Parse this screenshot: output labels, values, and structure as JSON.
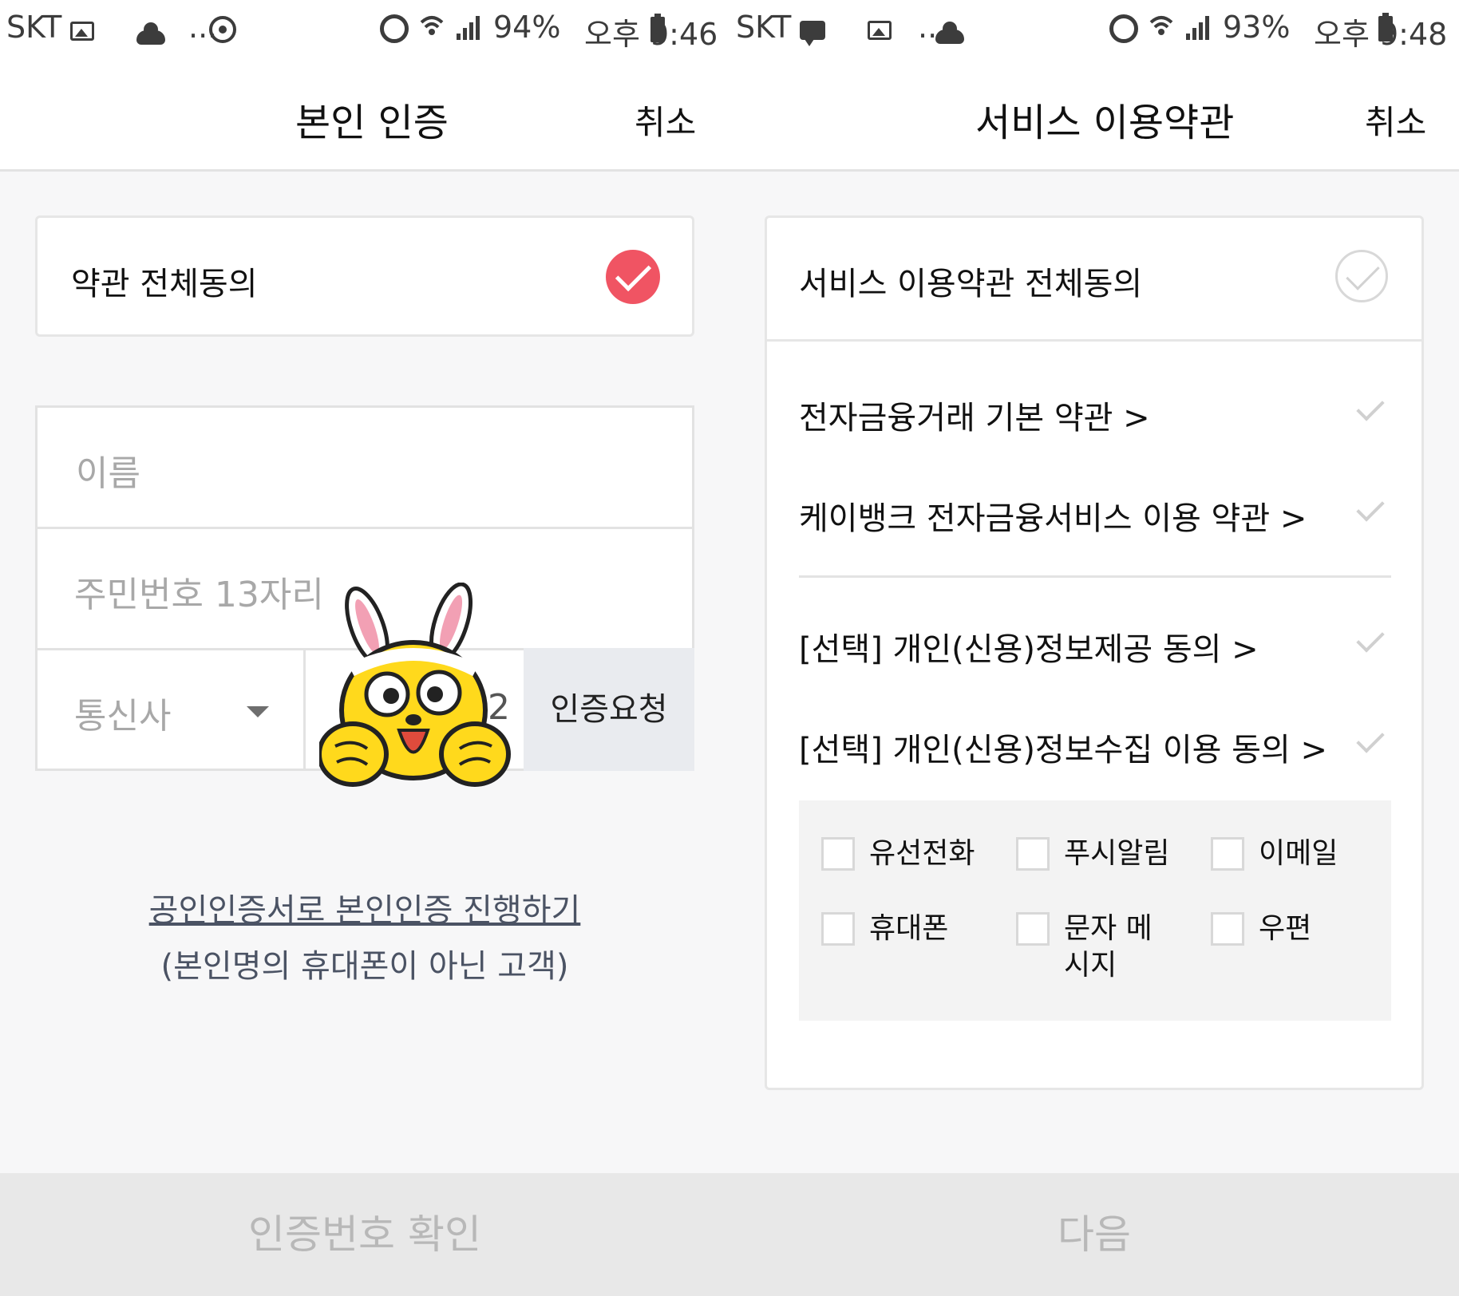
{
  "left": {
    "status": {
      "carrier": "SKT",
      "dots": "...",
      "battery": "94%",
      "time": "오후 9:46"
    },
    "header": {
      "title": "본인 인증",
      "cancel": "취소"
    },
    "agree_all": {
      "label": "약관 전체동의",
      "checked": true,
      "check_color": "#f05463"
    },
    "form": {
      "name_placeholder": "이름",
      "rrn_placeholder": "주민번호 13자리",
      "carrier_placeholder": "통신사",
      "phone_partial": "2",
      "request_button": "인증요청"
    },
    "links": {
      "cert_link": "공인인증서로 본인인증 진행하기",
      "cert_note": "(본인명의 휴대폰이 아닌 고객)"
    },
    "bottom_button": "인증번호 확인"
  },
  "right": {
    "status": {
      "carrier": "SKT",
      "dots": "...",
      "battery": "93%",
      "time": "오후 9:48"
    },
    "header": {
      "title": "서비스 이용약관",
      "cancel": "취소"
    },
    "agree_all": {
      "label": "서비스 이용약관 전체동의",
      "checked": false
    },
    "terms": [
      {
        "label": "전자금융거래 기본 약관 >"
      },
      {
        "label": "케이뱅크 전자금융서비스 이용 약관 >"
      },
      {
        "label": "[선택] 개인(신용)정보제공 동의 >"
      },
      {
        "label": "[선택] 개인(신용)정보수집 이용 동의 >"
      }
    ],
    "channels": [
      {
        "label": "유선전화",
        "checked": false
      },
      {
        "label": "푸시알림",
        "checked": false
      },
      {
        "label": "이메일",
        "checked": false
      },
      {
        "label": "휴대폰",
        "checked": false
      },
      {
        "label": "문자 메시지",
        "checked": false
      },
      {
        "label": "우편",
        "checked": false
      }
    ],
    "bottom_button": "다음"
  }
}
